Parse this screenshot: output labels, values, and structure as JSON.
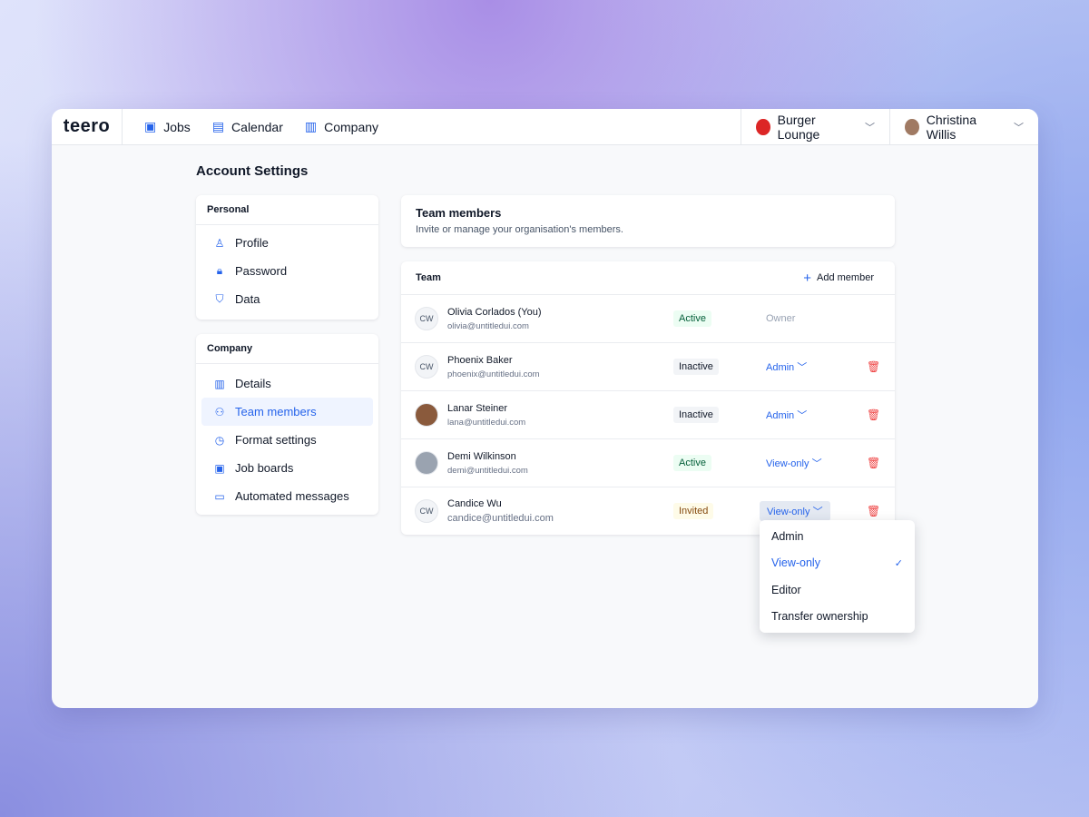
{
  "app": {
    "logo": "teero"
  },
  "nav": [
    {
      "label": "Jobs",
      "icon": "briefcase-icon"
    },
    {
      "label": "Calendar",
      "icon": "calendar-icon"
    },
    {
      "label": "Company",
      "icon": "building-icon"
    }
  ],
  "org": {
    "name": "Burger Lounge"
  },
  "user": {
    "name": "Christina Willis"
  },
  "page_title": "Account Settings",
  "personal": {
    "heading": "Personal",
    "items": [
      "Profile",
      "Password",
      "Data"
    ]
  },
  "company": {
    "heading": "Company",
    "items": [
      "Details",
      "Team members",
      "Format settings",
      "Job boards",
      "Automated messages"
    ],
    "active": "Team members"
  },
  "header": {
    "title": "Team members",
    "subtitle": "Invite or manage your organisation's members."
  },
  "team": {
    "heading": "Team",
    "add_label": "Add member",
    "members": [
      {
        "initials": "CW",
        "name": "Olivia Corlados (You)",
        "email": "olivia@untitledui.com",
        "status": "Active",
        "role": "Owner"
      },
      {
        "initials": "CW",
        "name": "Phoenix Baker",
        "email": "phoenix@untitledui.com",
        "status": "Inactive",
        "role": "Admin"
      },
      {
        "initials": "",
        "name": "Lanar Steiner",
        "email": "lana@untitledui.com",
        "status": "Inactive",
        "role": "Admin"
      },
      {
        "initials": "",
        "name": "Demi Wilkinson",
        "email": "demi@untitledui.com",
        "status": "Active",
        "role": "View-only"
      },
      {
        "initials": "CW",
        "name": "Candice Wu",
        "email": "candice@untitledui.com",
        "status": "Invited",
        "role": "View-only"
      }
    ]
  },
  "role_menu": {
    "options": [
      "Admin",
      "View-only",
      "Editor",
      "Transfer ownership"
    ],
    "selected": "View-only"
  }
}
